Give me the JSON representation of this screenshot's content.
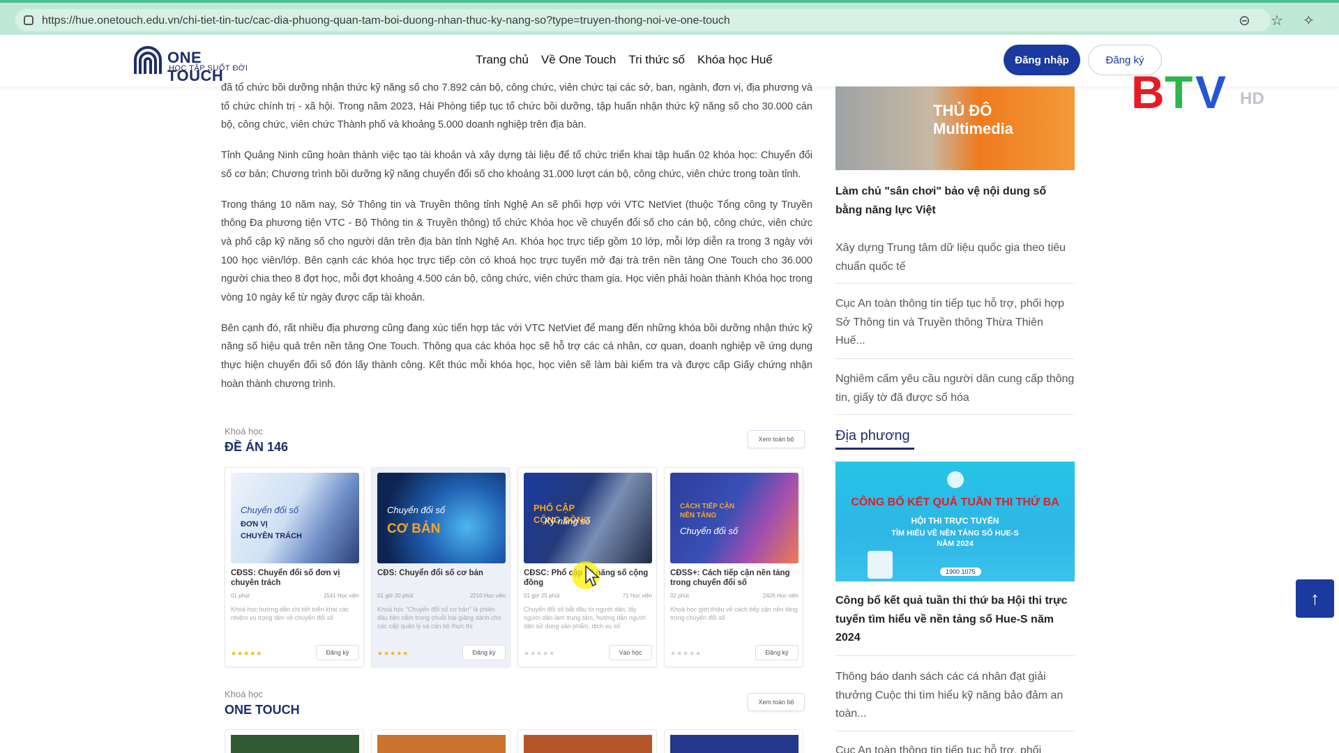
{
  "browser": {
    "url": "https://hue.onetouch.edu.vn/chi-tiet-tin-tuc/cac-dia-phuong-quan-tam-boi-duong-nhan-thuc-ky-nang-so?type=truyen-thong-noi-ve-one-touch",
    "icons": [
      "lock-icon",
      "reader-icon",
      "star-icon",
      "extensions-icon"
    ]
  },
  "header": {
    "logo_name": "ONE TOUCH",
    "logo_tagline": "HỌC TẬP SUỐT ĐỜI",
    "nav": [
      "Trang chủ",
      "Về One Touch",
      "Tri thức số",
      "Khóa học Huế"
    ],
    "login_label": "Đăng nhập",
    "register_label": "Đăng ký"
  },
  "watermark": {
    "b": "B",
    "t": "T",
    "v": "V",
    "hd": "HD"
  },
  "article": {
    "paragraphs": [
      "đã tổ chức bồi dưỡng nhận thức kỹ năng số cho 7.892 cán bộ, công chức, viên chức tại các sở, ban, ngành, đơn vị, địa phương và tổ chức chính trị - xã hội. Trong năm 2023, Hải Phòng tiếp tục tổ chức bồi dưỡng, tập huấn nhận thức kỹ năng số cho 30.000 cán bộ, công chức, viên chức Thành phố và khoảng 5.000 doanh nghiệp trên địa bàn.",
      "Tỉnh Quảng Ninh cũng hoàn thành việc tạo tài khoản và xây dựng tài liệu để tổ chức triển khai tập huấn 02 khóa học: Chuyển đổi số cơ bản; Chương trình bồi dưỡng kỹ năng chuyển đổi số cho khoảng 31.000 lượt cán bộ, công chức, viên chức trong toàn tỉnh.",
      "Trong tháng 10 năm nay, Sở Thông tin và Truyền thông tỉnh Nghệ An sẽ phối hợp với VTC NetViet (thuộc Tổng công ty Truyền thông Đa phương tiện VTC - Bộ Thông tin & Truyền thông) tổ chức Khóa học về chuyển đổi số cho cán bộ, công chức, viên chức và phổ cập kỹ năng số cho người dân trên địa bàn tỉnh Nghệ An. Khóa học trực tiếp gồm 10 lớp, mỗi lớp diễn ra trong 3 ngày với 100 học viên/lớp. Bên cạnh các khóa học trực tiếp còn có khoá học trực tuyến mở đại trà trên nền tảng One Touch cho 36.000 người chia theo 8 đợt học, mỗi đợt khoảng 4.500 cán bộ, công chức, viên chức tham gia. Học viên phải hoàn thành Khóa học trong vòng 10 ngày kể từ ngày được cấp tài khoản.",
      "Bên cạnh đó, rất nhiều địa phương cũng đang xúc tiến hợp tác với VTC NetViet để mang đến những khóa bồi dưỡng nhận thức kỹ năng số hiệu quả trên nền tảng One Touch. Thông qua các khóa học sẽ hỗ trợ các cá nhân, cơ quan, doanh nghiệp về ứng dụng thực hiện chuyển đổi số đón lấy thành công. Kết thúc mỗi khóa học, học viên sẽ làm bài kiểm tra và được cấp Giấy chứng nhận hoàn thành chương trình."
    ]
  },
  "section1": {
    "kicker": "Khoá học",
    "title": "ĐỀ ÁN 146",
    "view_all": "Xem toàn bộ",
    "cards": [
      {
        "thumb_caption": "Chuyển đổi số",
        "thumb_big": "ĐƠN VỊ\nCHUYÊN TRÁCH",
        "title": "CĐSS: Chuyển đổi số đơn vị chuyên trách",
        "meta_left": "01 phút",
        "meta_right": "1541 Học viên",
        "desc": "Khoá học hướng dẫn chi tiết triển khai các nhiệm vụ trọng tâm về chuyển đổi số",
        "stars": "★★★★★",
        "button": "Đăng ký"
      },
      {
        "thumb_caption": "Chuyển đổi số",
        "thumb_big": "CƠ BẢN",
        "title": "CĐS: Chuyển đổi số cơ bản",
        "meta_left": "01 giờ 20 phút",
        "meta_right": "2210 Học viên",
        "desc": "Khoá học \"Chuyển đổi số cơ bản\" là phiên đầu tiên nằm trong chuỗi bài giảng dành cho các cấp quản lý và cán bộ thực thi",
        "stars": "★★★★★",
        "button": "Đăng ký"
      },
      {
        "thumb_caption": "Kỹ năng số",
        "thumb_big": "PHỔ CẬP\nCỘNG ĐỒNG",
        "title": "CĐSC: Phổ cập kỹ năng số cộng đồng",
        "meta_left": "01 giờ 25 phút",
        "meta_right": "71 Học viên",
        "desc": "Chuyển đổi số bắt đầu từ người dân, lấy người dân làm trung tâm, hướng dẫn người dân sử dụng sản phẩm, dịch vụ số",
        "stars": "★★★★★",
        "button": "Vào học"
      },
      {
        "thumb_caption": "Chuyển đổi số",
        "thumb_big": "CÁCH TIẾP CẬN\nNỀN TẢNG",
        "title": "CĐSS+: Cách tiếp cận nền tảng trong chuyển đổi số",
        "meta_left": "02 phút",
        "meta_right": "2426 Học viên",
        "desc": "Khoá học giới thiệu về cách tiếp cận nền tảng trong chuyển đổi số",
        "stars": "★★★★★",
        "button": "Đăng ký"
      }
    ]
  },
  "section2": {
    "kicker": "Khoá học",
    "title": "ONE TOUCH",
    "view_all": "Xem toàn bộ"
  },
  "sidebar": {
    "top_image_text": "THỦ ĐÔ Multimedia",
    "news": [
      "Làm chủ \"sân chơi\" bảo vệ nội dung số bằng năng lực Việt",
      "Xây dựng Trung tâm dữ liệu quốc gia theo tiêu chuẩn quốc tế",
      "Cục An toàn thông tin tiếp tục hỗ trợ, phối hợp Sở Thông tin và Truyền thông Thừa Thiên Huế...",
      "Nghiêm cấm yêu cầu người dân cung cấp thông tin, giấy tờ đã được số hóa"
    ],
    "local_heading": "Địa phương",
    "banner": {
      "line1": "CÔNG BỐ KẾT QUẢ TUẦN THI THỨ BA",
      "line2": "HỘI THI TRỰC TUYẾN",
      "line3": "TÌM HIỂU VỀ NỀN TẢNG SỐ HUE-S\nNĂM 2024",
      "hotline": "1900 1075"
    },
    "local_news": [
      "Công bố kết quả tuần thi thứ ba Hội thi trực tuyến tìm hiểu về nền tảng số Hue-S năm 2024",
      "Thông báo danh sách các cá nhân đạt giải thưởng Cuộc thi tìm hiểu kỹ năng bảo đảm an toàn...",
      "Cục An toàn thông tin tiếp tục hỗ trợ, phối"
    ]
  },
  "scroll_top_label": "↑"
}
